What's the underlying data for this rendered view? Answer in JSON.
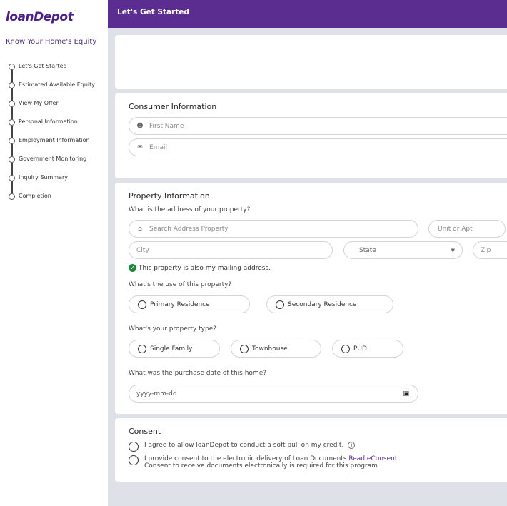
{
  "brand": {
    "logo_text": "loanDepot",
    "tm": "™",
    "accent": "#5b2d90"
  },
  "sidebar": {
    "title": "Know Your Home's Equity",
    "steps": [
      {
        "label": "Let's Get Started"
      },
      {
        "label": "Estimated Available Equity"
      },
      {
        "label": "View My Offer"
      },
      {
        "label": "Personal Information"
      },
      {
        "label": "Employment Information"
      },
      {
        "label": "Government Monitoring"
      },
      {
        "label": "Inquiry Summary"
      },
      {
        "label": "Completion"
      }
    ]
  },
  "header": {
    "title": "Let's Get Started"
  },
  "consumer": {
    "title": "Consumer Information",
    "first_name_placeholder": "First Name",
    "email_placeholder": "Email",
    "user_icon": "user-icon",
    "mail_icon": "mail-icon"
  },
  "property": {
    "title": "Property Information",
    "address_question": "What is the address of your property?",
    "address_placeholder": "Search Address Property",
    "unit_placeholder": "Unit or Apt",
    "city_placeholder": "City",
    "state_value": "State",
    "zip_placeholder": "Zip",
    "mailing_checkbox": "This property is also my mailing address.",
    "mailing_checked": true,
    "use_question": "What's the use of this property?",
    "use_options": [
      "Primary Residence",
      "Secondary Residence"
    ],
    "type_question": "What's your property type?",
    "type_options": [
      "Single Family",
      "Townhouse",
      "PUD"
    ],
    "date_question": "What was the purchase date of this home?",
    "date_placeholder": "yyyy-mm-dd"
  },
  "consent": {
    "title": "Consent",
    "soft_pull": "I agree to allow loanDepot to conduct a soft pull on my credit.",
    "econsent": "I provide consent to the electronic delivery of Loan Documents ",
    "econsent_link": "Read eConsent",
    "econsent_note": "Consent to receive documents electronically is required for this program"
  }
}
